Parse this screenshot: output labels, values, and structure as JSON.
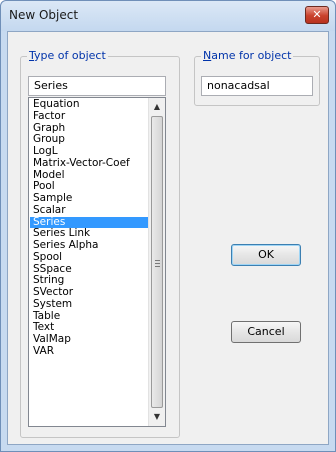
{
  "window": {
    "title": "New Object",
    "close_glyph": "✕"
  },
  "type_group": {
    "label_u": "T",
    "label_rest": "ype of object",
    "value": "Series"
  },
  "name_group": {
    "label_u": "N",
    "label_rest": "ame for object",
    "value": "nonacadsal"
  },
  "list": {
    "items": [
      "Equation",
      "Factor",
      "Graph",
      "Group",
      "LogL",
      "Matrix-Vector-Coef",
      "Model",
      "Pool",
      "Sample",
      "Scalar",
      "Series",
      "Series Link",
      "Series Alpha",
      "Spool",
      "SSpace",
      "String",
      "SVector",
      "System",
      "Table",
      "Text",
      "ValMap",
      "VAR"
    ],
    "selected": "Series"
  },
  "scrollbar": {
    "up_glyph": "▲",
    "down_glyph": "▼"
  },
  "buttons": {
    "ok": "OK",
    "cancel": "Cancel"
  },
  "colors": {
    "selection": "#3399ff",
    "group_label": "#0033aa",
    "close_button": "#c9412c"
  }
}
